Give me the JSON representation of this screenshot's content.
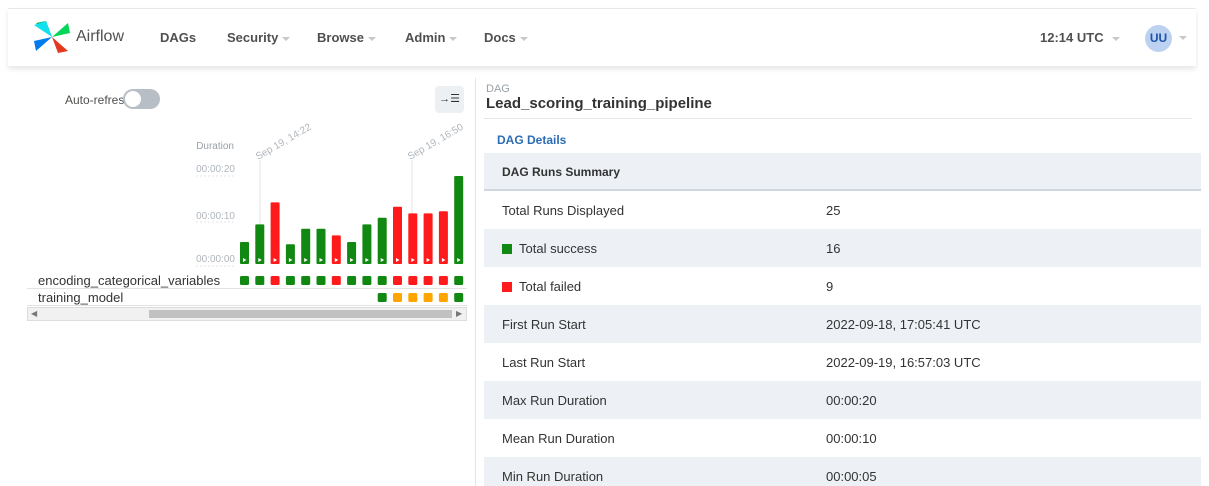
{
  "navbar": {
    "brand": "Airflow",
    "menu": [
      {
        "label": "DAGs",
        "dropdown": false
      },
      {
        "label": "Security",
        "dropdown": true
      },
      {
        "label": "Browse",
        "dropdown": true
      },
      {
        "label": "Admin",
        "dropdown": true
      },
      {
        "label": "Docs",
        "dropdown": true
      }
    ],
    "time": "12:14 UTC",
    "user_initials": "UU"
  },
  "grid": {
    "auto_refresh_label": "Auto-refresh",
    "auto_refresh_on": false,
    "collapse_icon": "→☰",
    "duration_label": "Duration",
    "tick_labels": [
      "00:00:20",
      "00:00:10",
      "00:00:00"
    ],
    "date_labels": [
      "Sep 19, 14:22",
      "Sep 19, 16:50"
    ],
    "tasks": [
      "encoding_categorical_variables",
      "training_model"
    ]
  },
  "chart_data": {
    "type": "bar",
    "ylabel": "Duration",
    "ylim": [
      0,
      22
    ],
    "y_unit": "seconds",
    "values": [
      5,
      9,
      14,
      4.5,
      8,
      8,
      6.5,
      5,
      9,
      10.5,
      13,
      11.5,
      11.5,
      12,
      20
    ],
    "status": [
      "success",
      "success",
      "failed",
      "success",
      "success",
      "success",
      "failed",
      "success",
      "success",
      "success",
      "failed",
      "failed",
      "failed",
      "failed",
      "success"
    ],
    "colors": {
      "success": "#118811",
      "failed": "#ff1b1b",
      "queued": "#ffa500"
    },
    "task_instances": {
      "encoding_categorical_variables": [
        "success",
        "success",
        "failed",
        "success",
        "success",
        "success",
        "failed",
        "success",
        "success",
        "success",
        "failed",
        "failed",
        "failed",
        "failed",
        "success"
      ],
      "training_model": [
        "",
        "",
        "",
        "",
        "",
        "",
        "",
        "",
        "",
        "success",
        "queued",
        "queued",
        "queued",
        "queued",
        "success"
      ]
    }
  },
  "dag": {
    "kicker": "DAG",
    "title": "Lead_scoring_training_pipeline",
    "tab": "DAG Details",
    "summary_title": "DAG Runs Summary",
    "rows": [
      {
        "label": "Total Runs Displayed",
        "value": "25",
        "marker": ""
      },
      {
        "label": "Total success",
        "value": "16",
        "marker": "success"
      },
      {
        "label": "Total failed",
        "value": "9",
        "marker": "failed"
      },
      {
        "label": "First Run Start",
        "value": "2022-09-18, 17:05:41 UTC",
        "marker": ""
      },
      {
        "label": "Last Run Start",
        "value": "2022-09-19, 16:57:03 UTC",
        "marker": ""
      },
      {
        "label": "Max Run Duration",
        "value": "00:00:20",
        "marker": ""
      },
      {
        "label": "Mean Run Duration",
        "value": "00:00:10",
        "marker": ""
      },
      {
        "label": "Min Run Duration",
        "value": "00:00:05",
        "marker": ""
      }
    ]
  }
}
